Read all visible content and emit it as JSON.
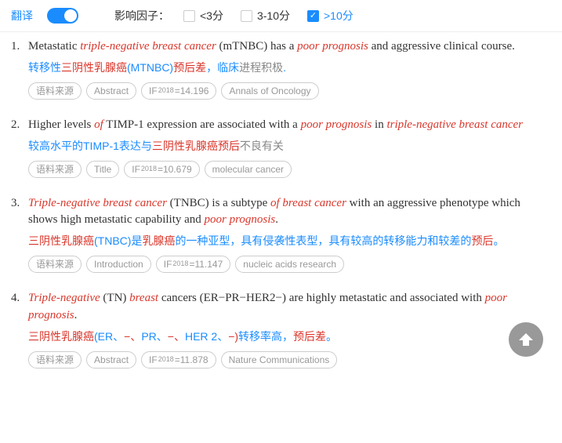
{
  "topbar": {
    "translate_label": "翻译",
    "if_label": "影响因子：",
    "options": [
      {
        "label": "<3分",
        "checked": false
      },
      {
        "label": "3-10分",
        "checked": false
      },
      {
        "label": ">10分",
        "checked": true
      }
    ]
  },
  "results": [
    {
      "num": "1.",
      "sentence": [
        {
          "t": "Metastatic ",
          "em": false
        },
        {
          "t": "triple-negative breast cancer",
          "em": true
        },
        {
          "t": " (mTNBC) has a ",
          "em": false
        },
        {
          "t": "poor prognosis",
          "em": true
        },
        {
          "t": " and aggressive clinical course.",
          "em": false
        }
      ],
      "translation": [
        {
          "t": "转移性",
          "cls": ""
        },
        {
          "t": "三阴性乳腺癌",
          "cls": "hl"
        },
        {
          "t": "(MTNBC)",
          "cls": ""
        },
        {
          "t": "预后差",
          "cls": "hl"
        },
        {
          "t": "，临床",
          "cls": ""
        },
        {
          "t": "进程积极",
          "cls": "gray"
        },
        {
          "t": ".",
          "cls": ""
        }
      ],
      "tags": {
        "source": "语料来源",
        "section": "Abstract",
        "if_year": "2018",
        "if_value": "=14.196",
        "journal": "Annals of Oncology"
      }
    },
    {
      "num": "2.",
      "sentence": [
        {
          "t": "Higher levels ",
          "em": false
        },
        {
          "t": "of",
          "em": true
        },
        {
          "t": " TIMP-1 expression are associated with a ",
          "em": false
        },
        {
          "t": "poor prognosis",
          "em": true
        },
        {
          "t": " in ",
          "em": false
        },
        {
          "t": "triple-negative breast cancer",
          "em": true
        }
      ],
      "translation": [
        {
          "t": "较高水平的TIMP-1表达与",
          "cls": ""
        },
        {
          "t": "三阴性乳腺癌预后",
          "cls": "hl"
        },
        {
          "t": "不良有关",
          "cls": "gray"
        }
      ],
      "tags": {
        "source": "语料来源",
        "section": "Title",
        "if_year": "2018",
        "if_value": "=10.679",
        "journal": "molecular cancer"
      }
    },
    {
      "num": "3.",
      "sentence": [
        {
          "t": "Triple-negative breast cancer",
          "em": true
        },
        {
          "t": " (TNBC) is a subtype ",
          "em": false
        },
        {
          "t": "of breast cancer",
          "em": true
        },
        {
          "t": " with an aggressive phenotype which shows high metastatic capability and ",
          "em": false
        },
        {
          "t": "poor prognosis",
          "em": true
        },
        {
          "t": ".",
          "em": false
        }
      ],
      "translation": [
        {
          "t": "三阴性乳腺癌",
          "cls": "hl"
        },
        {
          "t": "(TNBC)是",
          "cls": ""
        },
        {
          "t": "乳腺癌",
          "cls": "hl"
        },
        {
          "t": "的一种亚型，具有侵袭性表型，具有较高的转移能力和较差的",
          "cls": ""
        },
        {
          "t": "预后",
          "cls": "hl"
        },
        {
          "t": "。",
          "cls": ""
        }
      ],
      "tags": {
        "source": "语料来源",
        "section": "Introduction",
        "if_year": "2018",
        "if_value": "=11.147",
        "journal": "nucleic acids research"
      }
    },
    {
      "num": "4.",
      "sentence": [
        {
          "t": "Triple-negative",
          "em": true
        },
        {
          "t": " (TN) ",
          "em": false
        },
        {
          "t": "breast",
          "em": true
        },
        {
          "t": " cancers (ER−PR−HER2−) are highly metastatic and associated with ",
          "em": false
        },
        {
          "t": "poor prognosis",
          "em": true
        },
        {
          "t": ".",
          "em": false
        }
      ],
      "translation": [
        {
          "t": "三阴性乳腺癌",
          "cls": "hl"
        },
        {
          "t": "(ER、",
          "cls": ""
        },
        {
          "t": "−、",
          "cls": "hl"
        },
        {
          "t": "PR、",
          "cls": ""
        },
        {
          "t": "−、",
          "cls": "hl"
        },
        {
          "t": "HER 2、",
          "cls": ""
        },
        {
          "t": "−)",
          "cls": "hl"
        },
        {
          "t": "转移率高，",
          "cls": ""
        },
        {
          "t": "预后差",
          "cls": "hl"
        },
        {
          "t": "。",
          "cls": ""
        }
      ],
      "tags": {
        "source": "语料来源",
        "section": "Abstract",
        "if_year": "2018",
        "if_value": "=11.878",
        "journal": "Nature Communications"
      }
    }
  ]
}
